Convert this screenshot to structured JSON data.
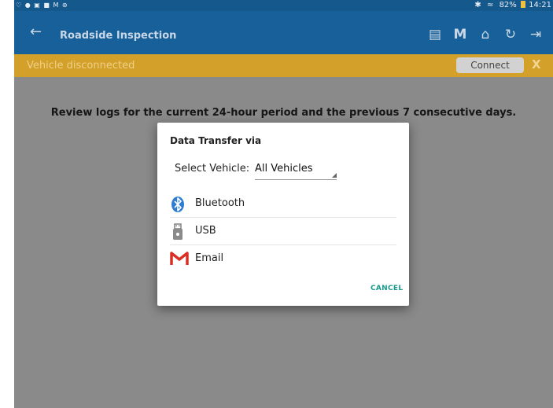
{
  "status_bar": {
    "left_icons": "♡ ● ▣ ■ M ⊛",
    "bluetooth": "✱",
    "wifi": "≈",
    "battery": "82%",
    "time": "14:21"
  },
  "app_bar": {
    "title": "Roadside Inspection",
    "back_glyph": "←",
    "action_glyphs": [
      "▤",
      "M",
      "⌂",
      "↻",
      "⇥"
    ]
  },
  "warning": {
    "message": "Vehicle disconnected",
    "connect_label": "Connect",
    "close_label": "X"
  },
  "main": {
    "review_text": "Review logs for the current 24-hour period and the previous 7 consecutive days."
  },
  "dialog": {
    "title": "Data Transfer via",
    "select_label": "Select Vehicle:",
    "select_value": "All Vehicles",
    "options": [
      {
        "label": "Bluetooth",
        "icon": "bluetooth-icon"
      },
      {
        "label": "USB",
        "icon": "usb-icon"
      },
      {
        "label": "Email",
        "icon": "gmail-icon"
      }
    ],
    "cancel_label": "CANCEL"
  },
  "colors": {
    "app_bar": "#17609a",
    "warning_bar": "#d3a02a",
    "accent": "#1a9a8a",
    "bluetooth": "#2f7dd1",
    "gmail_red": "#d93025"
  }
}
